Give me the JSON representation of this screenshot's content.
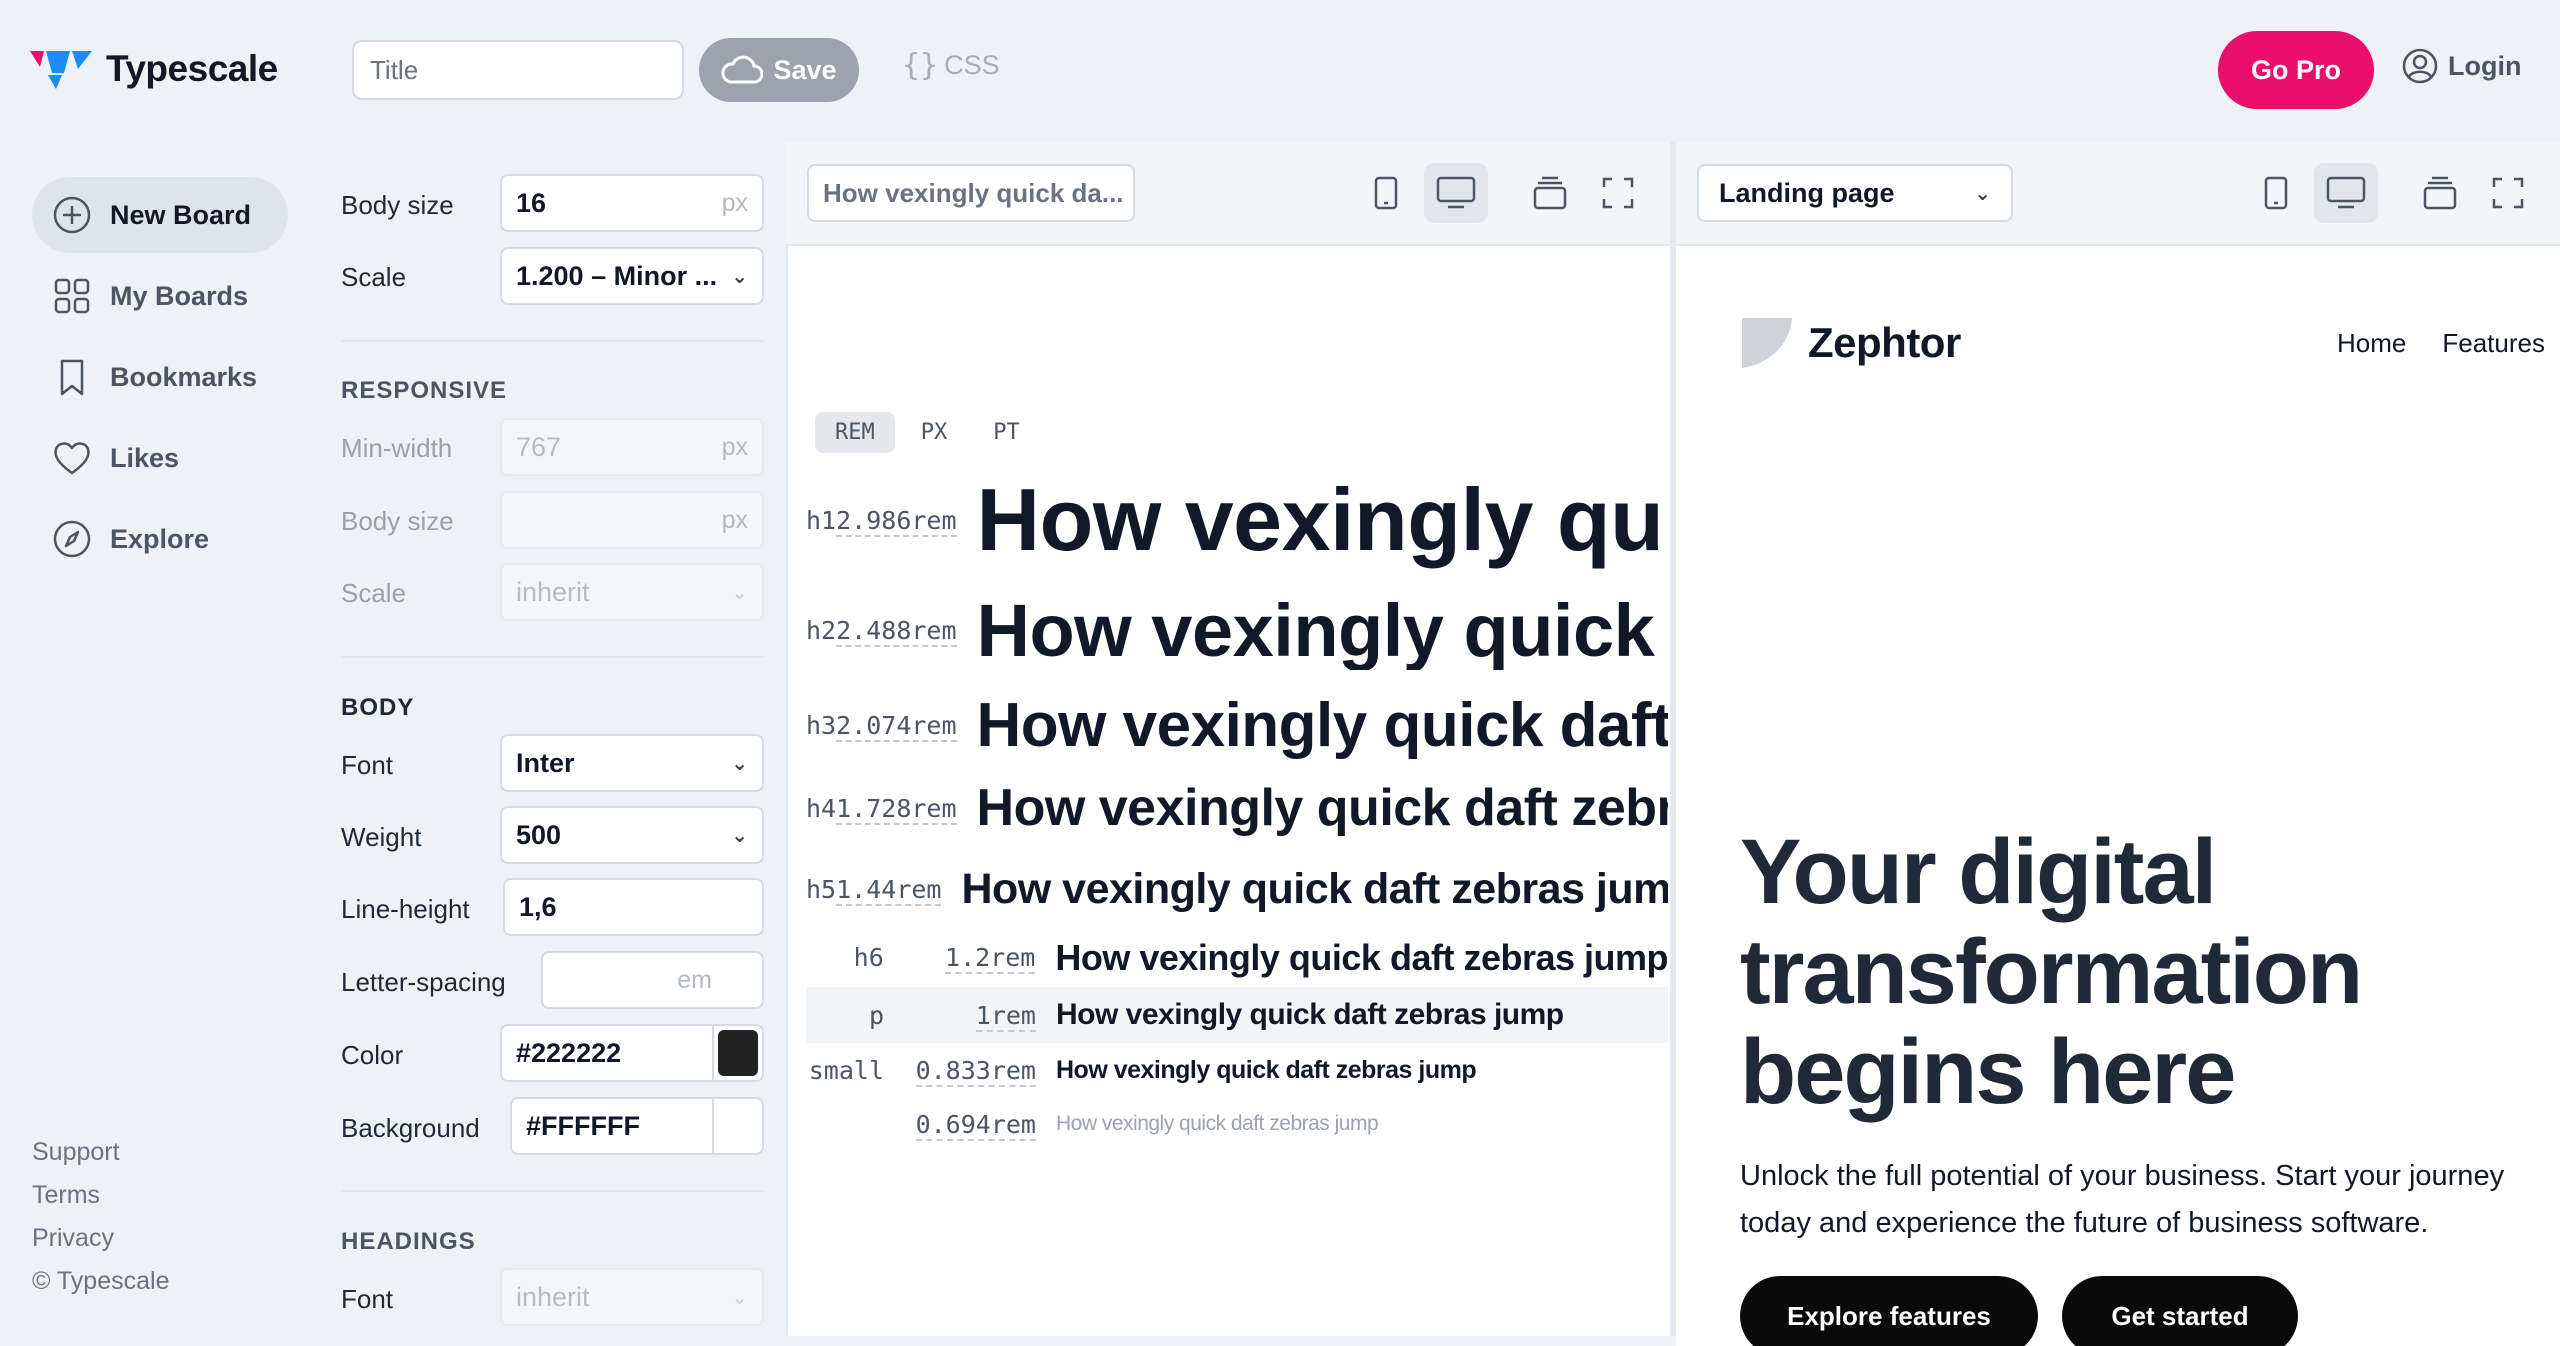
{
  "app": {
    "name": "Typescale",
    "accent": "#eb0f6c"
  },
  "topbar": {
    "title_placeholder": "Title",
    "save_label": "Save",
    "css_label": "CSS",
    "gopro_label": "Go Pro",
    "login_label": "Login"
  },
  "sidebar": {
    "items": [
      {
        "label": "New Board",
        "icon": "plus-circle-icon",
        "active": true
      },
      {
        "label": "My Boards",
        "icon": "grid-icon"
      },
      {
        "label": "Bookmarks",
        "icon": "bookmark-icon"
      },
      {
        "label": "Likes",
        "icon": "heart-icon"
      },
      {
        "label": "Explore",
        "icon": "compass-icon"
      }
    ],
    "footer": [
      "Support",
      "Terms",
      "Privacy",
      "© Typescale"
    ]
  },
  "settings": {
    "body_size": {
      "label": "Body size",
      "value": "16",
      "unit": "px"
    },
    "scale": {
      "label": "Scale",
      "value": "1.200 – Minor ..."
    },
    "responsive": {
      "heading": "RESPONSIVE",
      "min_width": {
        "label": "Min-width",
        "value": "767",
        "unit": "px"
      },
      "body_size": {
        "label": "Body size",
        "value": "",
        "unit": "px"
      },
      "scale": {
        "label": "Scale",
        "value": "inherit"
      }
    },
    "body": {
      "heading": "BODY",
      "font": {
        "label": "Font",
        "value": "Inter"
      },
      "weight": {
        "label": "Weight",
        "value": "500"
      },
      "line_height": {
        "label": "Line-height",
        "value": "1,6"
      },
      "letter_spacing": {
        "label": "Letter-spacing",
        "value": "",
        "unit": "em"
      },
      "color": {
        "label": "Color",
        "value": "#222222",
        "swatch": "#222222"
      },
      "background": {
        "label": "Background",
        "value": "#FFFFFF",
        "swatch": "#FFFFFF"
      }
    },
    "headings": {
      "heading": "HEADINGS",
      "font": {
        "label": "Font",
        "value": "inherit"
      }
    }
  },
  "scale_preview": {
    "sample_text": "How vexingly quick da...",
    "units": [
      "REM",
      "PX",
      "PT"
    ],
    "active_unit": "REM",
    "rows": [
      {
        "tag": "h1",
        "value": "2.986rem",
        "text": "How vexingly quick daft zebras jump"
      },
      {
        "tag": "h2",
        "value": "2.488rem",
        "text": "How vexingly quick daft zebras jump"
      },
      {
        "tag": "h3",
        "value": "2.074rem",
        "text": "How vexingly quick daft zebras jump"
      },
      {
        "tag": "h4",
        "value": "1.728rem",
        "text": "How vexingly quick daft zebras jump"
      },
      {
        "tag": "h5",
        "value": "1.44rem",
        "text": "How vexingly quick daft zebras jump"
      },
      {
        "tag": "h6",
        "value": "1.2rem",
        "text": "How vexingly quick daft zebras jump"
      },
      {
        "tag": "p",
        "value": "1rem",
        "text": "How vexingly quick daft zebras jump"
      },
      {
        "tag": "small",
        "value": "0.833rem",
        "text": "How vexingly quick daft zebras jump"
      },
      {
        "tag": "",
        "value": "0.694rem",
        "text": "How vexingly quick daft zebras jump"
      }
    ]
  },
  "landing_preview": {
    "preset": "Landing page",
    "brand": "Zephtor",
    "nav": [
      "Home",
      "Features"
    ],
    "hero_lines": [
      "Your digital",
      "transformation",
      "begins here"
    ],
    "sub_lines": [
      "Unlock the full potential of your business. Start your journey",
      "today and experience the future of business software."
    ],
    "cta_primary": "Explore features",
    "cta_secondary": "Get started"
  }
}
